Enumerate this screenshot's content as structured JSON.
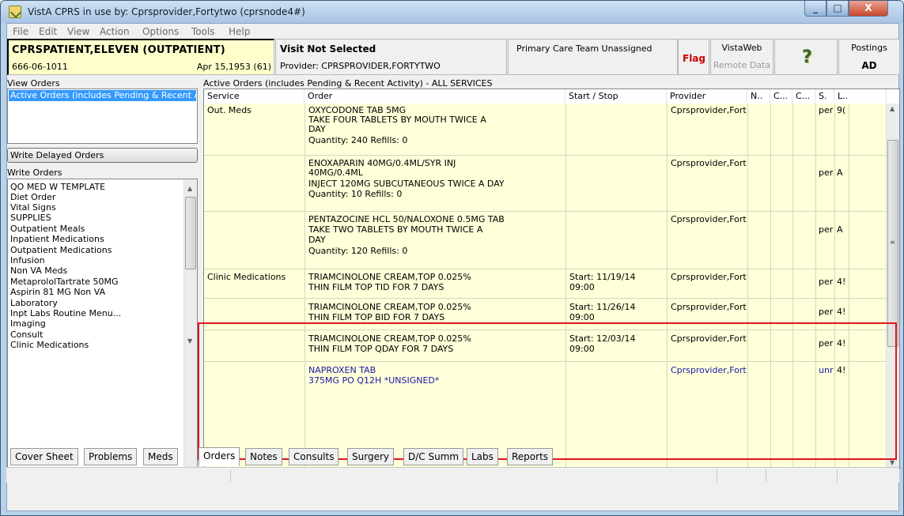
{
  "window": {
    "title": "VistA CPRS in use by: Cprsprovider,Fortytwo  (cprsnode4#)",
    "minimize": "_",
    "maximize": "□",
    "close": "X"
  },
  "menu": [
    "File",
    "Edit",
    "View",
    "Action",
    "Options",
    "Tools",
    "Help"
  ],
  "patient": {
    "name": "CPRSPATIENT,ELEVEN (OUTPATIENT)",
    "ssn": "666-06-1011",
    "dob": "Apr 15,1953 (61)"
  },
  "visit": {
    "title": "Visit Not Selected",
    "provider": "Provider:  CPRSPROVIDER,FORTYTWO"
  },
  "primary_care": "Primary Care Team Unassigned",
  "flag": "Flag",
  "vistaweb": {
    "label": "VistaWeb",
    "remote": "Remote Data"
  },
  "help_icon": "question-mark-icon",
  "postings": {
    "label": "Postings",
    "value": "AD"
  },
  "left": {
    "view_orders_label": "View Orders",
    "view_orders_selected": "Active Orders (includes Pending & Recent Activity)",
    "write_delayed": "Write Delayed Orders",
    "write_orders_label": "Write Orders",
    "write_orders": [
      "QO MED W TEMPLATE",
      "Diet Order",
      "Vital Signs",
      "SUPPLIES",
      "Outpatient Meals",
      "Inpatient Medications",
      "Outpatient Medications",
      "Infusion",
      "Non VA Meds",
      "MetaprololTartrate 50MG",
      "Aspirin 81 MG Non VA",
      "Laboratory",
      "Inpt Labs Routine Menu...",
      "Imaging",
      "Consult",
      "Clinic Medications"
    ]
  },
  "orders": {
    "title": "Active Orders (includes Pending & Recent Activity) - ALL SERVICES",
    "columns": [
      "Service",
      "Order",
      "Start / Stop",
      "Provider",
      "N..",
      "C...",
      "C...",
      "S.",
      "L.."
    ],
    "rows": [
      {
        "service": "Out. Meds",
        "order": [
          "OXYCODONE TAB 5MG",
          "TAKE FOUR TABLETS BY MOUTH TWICE A",
          "DAY",
          "Quantity: 240 Refills: 0"
        ],
        "start": [],
        "provider": "Cprsprovider,Fortyt",
        "status": "per",
        "loc": "9("
      },
      {
        "service": "",
        "order": [
          "ENOXAPARIN 40MG/0.4ML/SYR INJ",
          "40MG/0.4ML",
          "INJECT 120MG SUBCUTANEOUS TWICE A DAY",
          "Quantity: 10 Refills: 0"
        ],
        "start": [],
        "provider": "Cprsprovider,Fortyt",
        "status": "per",
        "loc": "A"
      },
      {
        "service": "",
        "order": [
          "PENTAZOCINE HCL 50/NALOXONE 0.5MG TAB",
          "TAKE TWO TABLETS BY MOUTH TWICE A",
          "DAY",
          "Quantity: 120 Refills: 0"
        ],
        "start": [],
        "provider": "Cprsprovider,Fortyt",
        "status": "per",
        "loc": "A"
      },
      {
        "service": "Clinic Medications",
        "order": [
          "TRIAMCINOLONE CREAM,TOP 0.025%",
          "THIN FILM TOP TID FOR 7 DAYS"
        ],
        "start": [
          "Start: 11/19/14",
          "09:00"
        ],
        "provider": "Cprsprovider,Fortyt",
        "status": "per",
        "loc": "4!"
      },
      {
        "service": "",
        "order": [
          "TRIAMCINOLONE CREAM,TOP 0.025%",
          "THIN FILM TOP BID FOR 7 DAYS"
        ],
        "start": [
          "Start: 11/26/14",
          "09:00"
        ],
        "provider": "Cprsprovider,Fortyt",
        "status": "per",
        "loc": "4!"
      },
      {
        "service": "",
        "order": [
          "TRIAMCINOLONE CREAM,TOP 0.025%",
          "THIN FILM TOP QDAY FOR 7 DAYS"
        ],
        "start": [
          "Start: 12/03/14",
          "09:00"
        ],
        "provider": "Cprsprovider,Fortyt",
        "status": "per",
        "loc": "4!"
      },
      {
        "service": "",
        "order": [
          "NAPROXEN TAB",
          "375MG PO Q12H *UNSIGNED*"
        ],
        "start": [],
        "provider": "Cprsprovider,Fortyt",
        "status": "unr",
        "loc": "4!"
      }
    ]
  },
  "tabs": [
    "Cover Sheet",
    "Problems",
    "Meds",
    "Orders",
    "Notes",
    "Consults",
    "Surgery",
    "D/C Summ",
    "Labs",
    "Reports"
  ],
  "active_tab": "Orders",
  "colors": {
    "highlight_border": "#e0161b",
    "unsigned_text": "#1a1aa6",
    "flag": "#cc0000",
    "row_bg": "#ffffd9",
    "patient_bg": "#ffffcc"
  }
}
